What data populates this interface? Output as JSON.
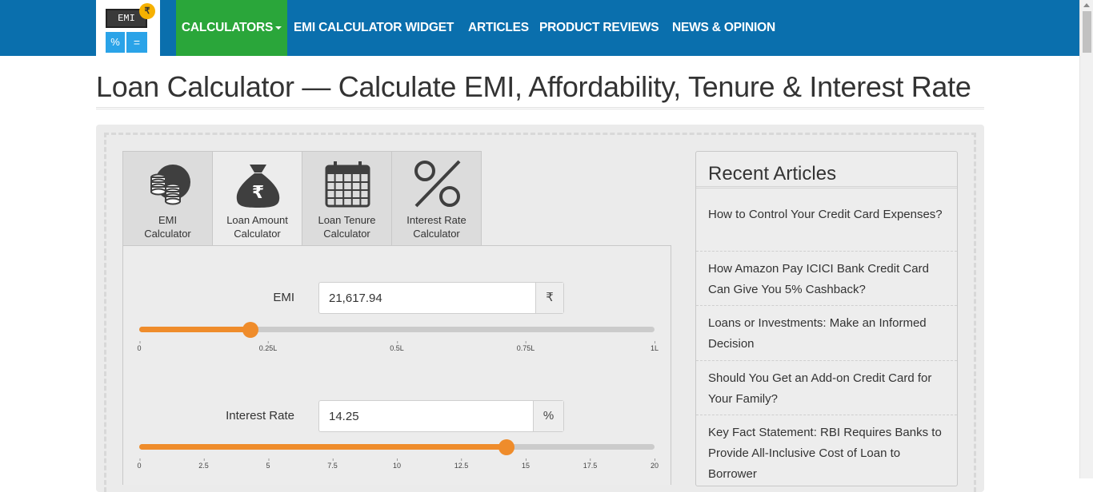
{
  "logo": {
    "screen_text": "EMI",
    "coin_symbol": "₹",
    "pad_left": "%",
    "pad_right": "="
  },
  "nav": {
    "items": [
      {
        "label": "CALCULATORS",
        "active": true
      },
      {
        "label": "EMI CALCULATOR WIDGET"
      },
      {
        "label": "ARTICLES"
      },
      {
        "label": "PRODUCT REVIEWS"
      },
      {
        "label": "NEWS & OPINION"
      }
    ]
  },
  "page": {
    "title": "Loan Calculator — Calculate EMI, Affordability, Tenure & Interest Rate"
  },
  "tabs": [
    {
      "label_line1": "EMI",
      "label_line2": "Calculator",
      "icon": "coins-icon"
    },
    {
      "label_line1": "Loan Amount",
      "label_line2": "Calculator",
      "icon": "money-bag-icon",
      "active": true
    },
    {
      "label_line1": "Loan Tenure",
      "label_line2": "Calculator",
      "icon": "calendar-icon"
    },
    {
      "label_line1": "Interest Rate",
      "label_line2": "Calculator",
      "icon": "percent-icon"
    }
  ],
  "calculator": {
    "emi": {
      "label": "EMI",
      "value": "21,617.94",
      "unit": "₹",
      "slider_fraction": 0.216,
      "ticks": [
        "0",
        "0.25L",
        "0.5L",
        "0.75L",
        "1L"
      ]
    },
    "interest": {
      "label": "Interest Rate",
      "value": "14.25",
      "unit": "%",
      "slider_fraction": 0.7125,
      "ticks": [
        "0",
        "2.5",
        "5",
        "7.5",
        "10",
        "12.5",
        "15",
        "17.5",
        "20"
      ]
    }
  },
  "sidebar": {
    "title": "Recent Articles",
    "articles": [
      "How to Control Your Credit Card Expenses?",
      "How Amazon Pay ICICI Bank Credit Card Can Give You 5% Cashback?",
      "Loans or Investments: Make an Informed Decision",
      "Should You Get an Add-on Credit Card for Your Family?",
      "Key Fact Statement: RBI Requires Banks to Provide All-Inclusive Cost of Loan to Borrower"
    ]
  },
  "colors": {
    "header": "#0a6fad",
    "nav_active": "#2aa63a",
    "slider_fill": "#ef8c2b"
  }
}
